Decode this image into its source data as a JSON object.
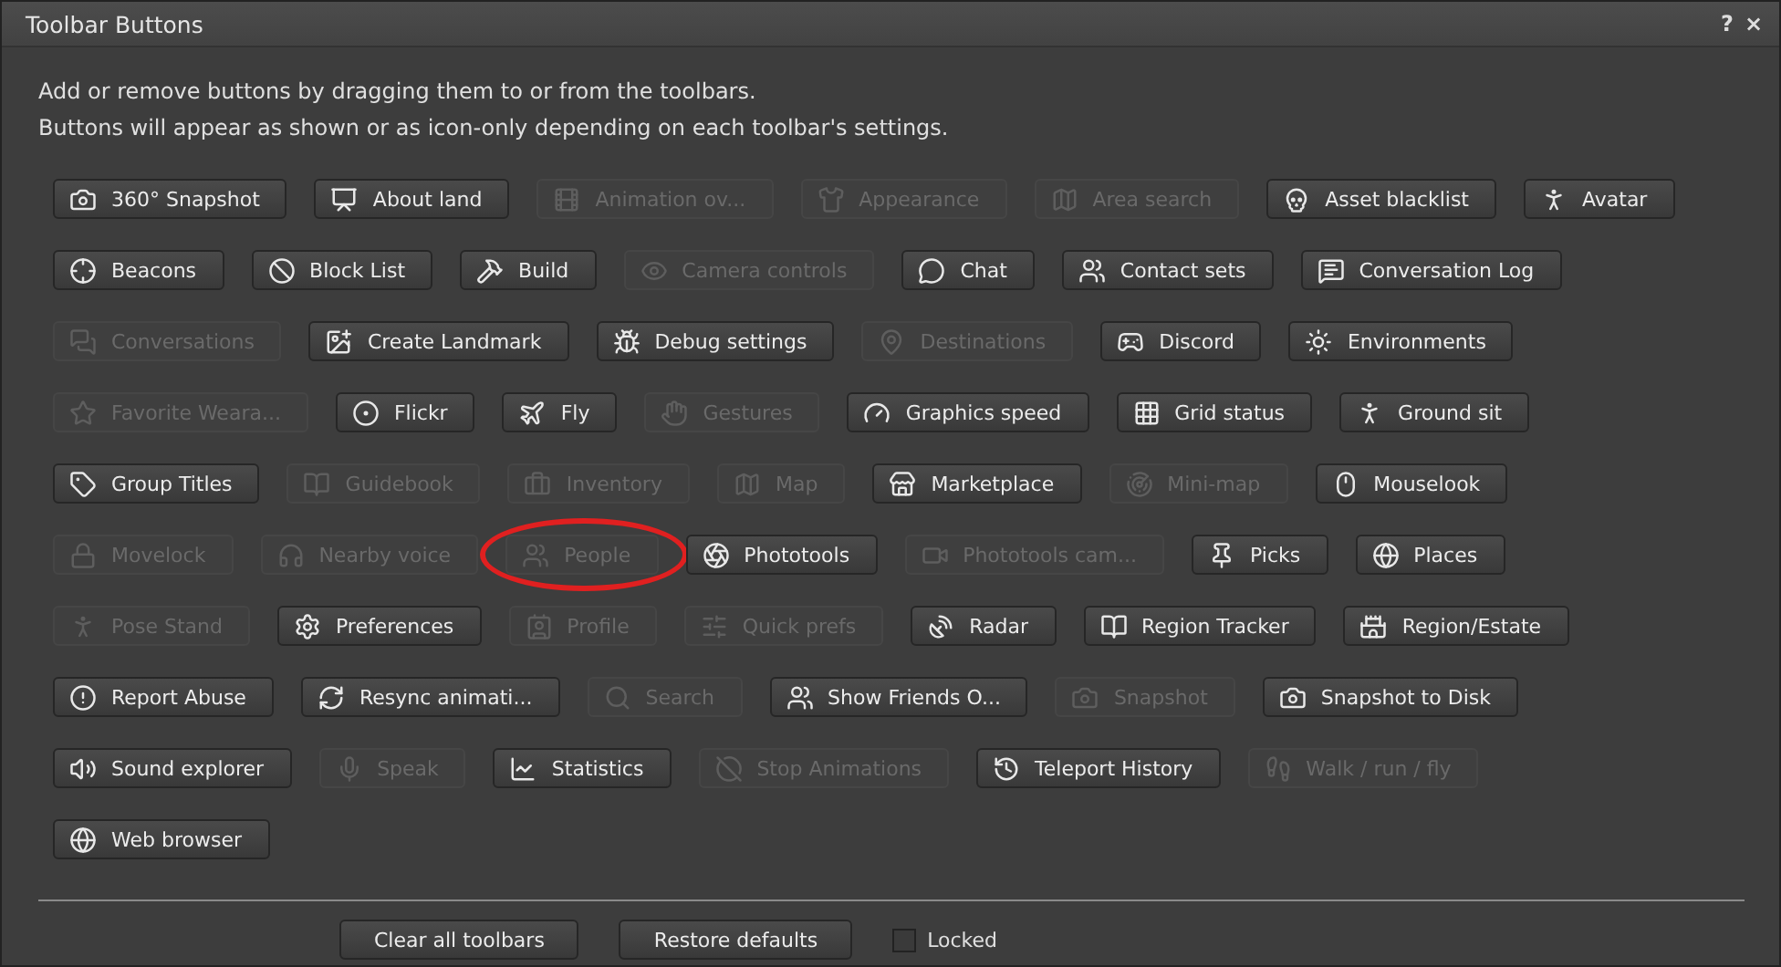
{
  "window": {
    "title": "Toolbar Buttons",
    "help": "?",
    "close": "×"
  },
  "intro": [
    "Add or remove buttons by dragging them to or from the toolbars.",
    "Buttons will appear as shown or as icon-only depending on each toolbar's settings."
  ],
  "button_rows": [
    [
      {
        "label": "360° Snapshot",
        "disabled": false,
        "circled": false
      },
      {
        "label": "About land",
        "disabled": false,
        "circled": false
      },
      {
        "label": "Animation ov...",
        "disabled": true,
        "circled": false
      },
      {
        "label": "Appearance",
        "disabled": true,
        "circled": false
      },
      {
        "label": "Area search",
        "disabled": true,
        "circled": false
      },
      {
        "label": "Asset blacklist",
        "disabled": false,
        "circled": false
      },
      {
        "label": "Avatar",
        "disabled": false,
        "circled": false
      }
    ],
    [
      {
        "label": "Beacons",
        "disabled": false,
        "circled": false
      },
      {
        "label": "Block List",
        "disabled": false,
        "circled": false
      },
      {
        "label": "Build",
        "disabled": false,
        "circled": false
      },
      {
        "label": "Camera controls",
        "disabled": true,
        "circled": false
      },
      {
        "label": "Chat",
        "disabled": false,
        "circled": false
      },
      {
        "label": "Contact sets",
        "disabled": false,
        "circled": false
      },
      {
        "label": "Conversation Log",
        "disabled": false,
        "circled": false
      }
    ],
    [
      {
        "label": "Conversations",
        "disabled": true,
        "circled": false
      },
      {
        "label": "Create Landmark",
        "disabled": false,
        "circled": false
      },
      {
        "label": "Debug settings",
        "disabled": false,
        "circled": false
      },
      {
        "label": "Destinations",
        "disabled": true,
        "circled": false
      },
      {
        "label": "Discord",
        "disabled": false,
        "circled": false
      },
      {
        "label": "Environments",
        "disabled": false,
        "circled": false
      }
    ],
    [
      {
        "label": "Favorite Weara...",
        "disabled": true,
        "circled": false
      },
      {
        "label": "Flickr",
        "disabled": false,
        "circled": false
      },
      {
        "label": "Fly",
        "disabled": false,
        "circled": false
      },
      {
        "label": "Gestures",
        "disabled": true,
        "circled": false
      },
      {
        "label": "Graphics speed",
        "disabled": false,
        "circled": false
      },
      {
        "label": "Grid status",
        "disabled": false,
        "circled": false
      },
      {
        "label": "Ground sit",
        "disabled": false,
        "circled": false
      }
    ],
    [
      {
        "label": "Group Titles",
        "disabled": false,
        "circled": false
      },
      {
        "label": "Guidebook",
        "disabled": true,
        "circled": false
      },
      {
        "label": "Inventory",
        "disabled": true,
        "circled": false
      },
      {
        "label": "Map",
        "disabled": true,
        "circled": false
      },
      {
        "label": "Marketplace",
        "disabled": false,
        "circled": false
      },
      {
        "label": "Mini-map",
        "disabled": true,
        "circled": false
      },
      {
        "label": "Mouselook",
        "disabled": false,
        "circled": false
      }
    ],
    [
      {
        "label": "Movelock",
        "disabled": true,
        "circled": false
      },
      {
        "label": "Nearby voice",
        "disabled": true,
        "circled": false
      },
      {
        "label": "People",
        "disabled": true,
        "circled": true
      },
      {
        "label": "Phototools",
        "disabled": false,
        "circled": false
      },
      {
        "label": "Phototools cam...",
        "disabled": true,
        "circled": false
      },
      {
        "label": "Picks",
        "disabled": false,
        "circled": false
      },
      {
        "label": "Places",
        "disabled": false,
        "circled": false
      }
    ],
    [
      {
        "label": "Pose Stand",
        "disabled": true,
        "circled": false
      },
      {
        "label": "Preferences",
        "disabled": false,
        "circled": false
      },
      {
        "label": "Profile",
        "disabled": true,
        "circled": false
      },
      {
        "label": "Quick prefs",
        "disabled": true,
        "circled": false
      },
      {
        "label": "Radar",
        "disabled": false,
        "circled": false
      },
      {
        "label": "Region Tracker",
        "disabled": false,
        "circled": false
      },
      {
        "label": "Region/Estate",
        "disabled": false,
        "circled": false
      }
    ],
    [
      {
        "label": "Report Abuse",
        "disabled": false,
        "circled": false
      },
      {
        "label": "Resync animati...",
        "disabled": false,
        "circled": false
      },
      {
        "label": "Search",
        "disabled": true,
        "circled": false
      },
      {
        "label": "Show Friends O...",
        "disabled": false,
        "circled": false
      },
      {
        "label": "Snapshot",
        "disabled": true,
        "circled": false
      },
      {
        "label": "Snapshot to Disk",
        "disabled": false,
        "circled": false
      }
    ],
    [
      {
        "label": "Sound explorer",
        "disabled": false,
        "circled": false
      },
      {
        "label": "Speak",
        "disabled": true,
        "circled": false
      },
      {
        "label": "Statistics",
        "disabled": false,
        "circled": false
      },
      {
        "label": "Stop Animations",
        "disabled": true,
        "circled": false
      },
      {
        "label": "Teleport History",
        "disabled": false,
        "circled": false
      },
      {
        "label": "Walk / run / fly",
        "disabled": true,
        "circled": false
      }
    ],
    [
      {
        "label": "Web browser",
        "disabled": false,
        "circled": false
      }
    ]
  ],
  "footer": {
    "buttons": [
      "Clear all toolbars",
      "Restore defaults"
    ],
    "locked": {
      "label": "Locked",
      "checked": false
    }
  }
}
